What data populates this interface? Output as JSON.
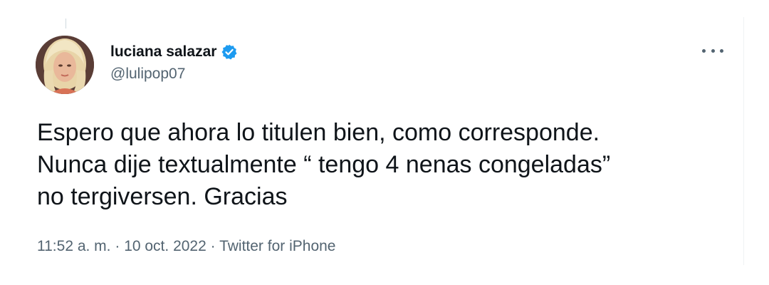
{
  "author": {
    "display_name": "luciana salazar",
    "handle": "@lulipop07",
    "verified": true,
    "avatar_icon": "profile-photo"
  },
  "tweet": {
    "lines": [
      "Espero que ahora lo titulen bien, como corresponde.",
      "Nunca dije textualmente “ tengo 4 nenas congeladas”",
      "no tergiversen. Gracias"
    ]
  },
  "meta": {
    "time": "11:52 a. m.",
    "separator": " · ",
    "date": "10 oct. 2022",
    "source": "Twitter for iPhone"
  },
  "icons": {
    "verified": "verified-badge-icon",
    "more": "more-options-icon"
  },
  "colors": {
    "text": "#0f1419",
    "secondary": "#536471",
    "verified_blue": "#1d9bf0"
  }
}
